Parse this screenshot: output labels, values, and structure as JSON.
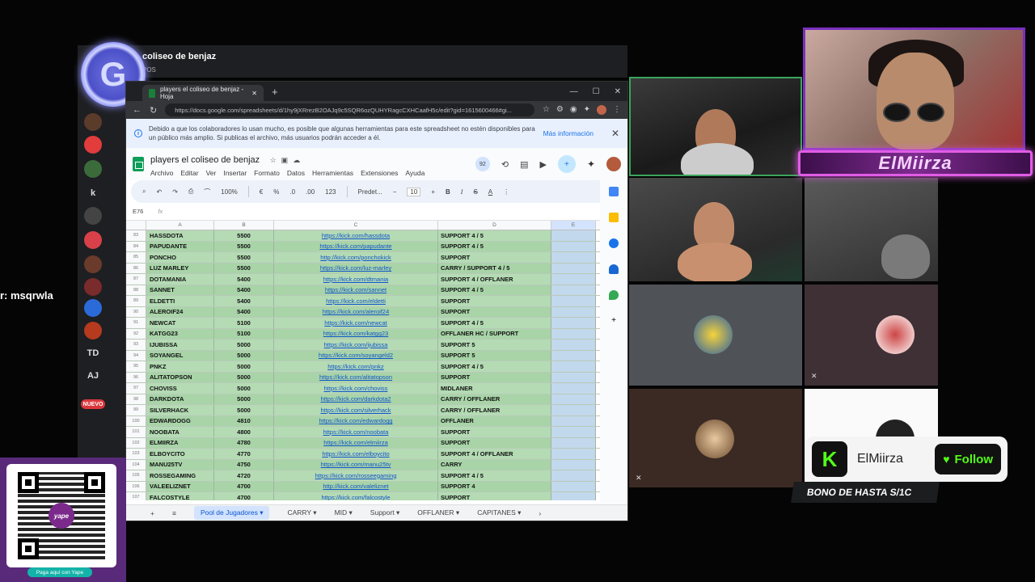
{
  "stream": {
    "side_text": "r: msqrwla",
    "streamer_name": "ElMiirza",
    "kick_follow_label": "Follow",
    "kick_logo": "K",
    "bono_text": "BONO DE HASTA S/1C",
    "yape_caption": "Paga aquí con Yape",
    "yape_logo": "yape"
  },
  "discord": {
    "logo_letter": "G",
    "server_name": "coliseo de benjaz",
    "server_sub": "POS",
    "badge_new": "NUEVO",
    "text_servers": [
      "k",
      "TD",
      "AJ"
    ]
  },
  "browser": {
    "tab_title": "players el coliseo de benjaz - Hoja",
    "url": "https://docs.google.com/spreadsheets/d/1hy9jXRrezB2OAJq9c5SQR6ozQUHYRagcCXHCaafH5c/edit?gid=1615600466#gi..."
  },
  "notice": {
    "message": "Debido a que los colaboradores lo usan mucho, es posible que algunas herramientas para este spreadsheet no estén disponibles para un público más amplio. Si publicas el archivo, más usuarios podrán acceder a él.",
    "more_link": "Más información"
  },
  "doc": {
    "title": "players el coliseo de benjaz",
    "menu": [
      "Archivo",
      "Editar",
      "Ver",
      "Insertar",
      "Formato",
      "Datos",
      "Herramientas",
      "Extensiones",
      "Ayuda"
    ],
    "badge": "92"
  },
  "toolbar": {
    "zoom": "100%",
    "currency": "€",
    "percent": "%",
    "dec_less": ".0",
    "dec_more": ".00",
    "num_format": "123",
    "font": "Predet...",
    "font_size": "10",
    "bold": "B",
    "italic": "I",
    "strike": "S",
    "color": "A"
  },
  "formula_bar": {
    "cell_ref": "E76",
    "fx": "fx"
  },
  "columns": [
    "A",
    "B",
    "C",
    "D",
    "E"
  ],
  "rows": [
    {
      "n": "83",
      "name": "HASSDOTA",
      "mmr": "5500",
      "link": "https://kick.com/hassdota",
      "role": "SUPPORT 4 / 5"
    },
    {
      "n": "84",
      "name": "PAPUDANTE",
      "mmr": "5500",
      "link": "https://kick.com/papudante",
      "role": "SUPPORT 4 / 5"
    },
    {
      "n": "85",
      "name": "PONCHO",
      "mmr": "5500",
      "link": "http://kick.com/ponchokick",
      "role": "SUPPORT"
    },
    {
      "n": "86",
      "name": "LUZ MARLEY",
      "mmr": "5500",
      "link": "https://kick.com/luz-marley",
      "role": "CARRY / SUPPORT 4 / 5"
    },
    {
      "n": "87",
      "name": "DOTAMANIA",
      "mmr": "5400",
      "link": "https://kick.com/dtmania",
      "role": "SUPPORT 4 / OFFLANER"
    },
    {
      "n": "88",
      "name": "SANNET",
      "mmr": "5400",
      "link": "https://kick.com/sannet",
      "role": "SUPPORT 4 / 5"
    },
    {
      "n": "89",
      "name": "ELDETTI",
      "mmr": "5400",
      "link": "https://kick.com/eldetti",
      "role": "SUPPORT"
    },
    {
      "n": "90",
      "name": "ALEROIF24",
      "mmr": "5400",
      "link": "https://kick.com/aleroif24",
      "role": "SUPPORT"
    },
    {
      "n": "91",
      "name": "NEWCAT",
      "mmr": "5100",
      "link": "https://kick.com/newcat",
      "role": "SUPPORT 4 / 5"
    },
    {
      "n": "92",
      "name": "KATGG23",
      "mmr": "5100",
      "link": "https://kick.com/katgg23",
      "role": "OFFLANER HC / SUPPORT"
    },
    {
      "n": "93",
      "name": "IJUBISSA",
      "mmr": "5000",
      "link": "https://kick.com/ijubissa",
      "role": "SUPPORT 5"
    },
    {
      "n": "94",
      "name": "SOYANGEL",
      "mmr": "5000",
      "link": "https://kick.com/soyangeld2",
      "role": "SUPPORT 5"
    },
    {
      "n": "95",
      "name": "PNKZ",
      "mmr": "5000",
      "link": "https://kick.com/pnkz",
      "role": "SUPPORT 4 / 5"
    },
    {
      "n": "96",
      "name": "ALITATOPSON",
      "mmr": "5000",
      "link": "https://kick.com/alitatopson",
      "role": "SUPPORT"
    },
    {
      "n": "97",
      "name": "CHOVISS",
      "mmr": "5000",
      "link": "https://kick.com/choviss",
      "role": "MIDLANER"
    },
    {
      "n": "98",
      "name": "DARKDOTA",
      "mmr": "5000",
      "link": "https://kick.com/darkdota2",
      "role": "CARRY / OFFLANER"
    },
    {
      "n": "99",
      "name": "SILVERHACK",
      "mmr": "5000",
      "link": "https://kick.com/silverhack",
      "role": "CARRY / OFFLANER"
    },
    {
      "n": "100",
      "name": "EDWARDOGG",
      "mmr": "4810",
      "link": "https://kick.com/edwardogg",
      "role": "OFFLANER"
    },
    {
      "n": "101",
      "name": "NOOBATA",
      "mmr": "4800",
      "link": "https://kick.com/noobata",
      "role": "SUPPORT"
    },
    {
      "n": "102",
      "name": "ELMIIRZA",
      "mmr": "4780",
      "link": "https://kick.com/elmiirza",
      "role": "SUPPORT"
    },
    {
      "n": "103",
      "name": "ELBOYCITO",
      "mmr": "4770",
      "link": "https://kick.com/elboycito",
      "role": "SUPPORT 4 / OFFLANER"
    },
    {
      "n": "104",
      "name": "MANU25TV",
      "mmr": "4750",
      "link": "https://kick.com/manu25tv",
      "role": "CARRY"
    },
    {
      "n": "105",
      "name": "ROSSEGAMING",
      "mmr": "4720",
      "link": "https://kick.com/rosseegaming",
      "role": "SUPPORT 4 / 5"
    },
    {
      "n": "106",
      "name": "VALEELIZNET",
      "mmr": "4700",
      "link": "http://kick.com/valeliznet",
      "role": "SUPPORT 4"
    },
    {
      "n": "107",
      "name": "FALCOSTYLE",
      "mmr": "4700",
      "link": "https://kick.com/falcostyle",
      "role": "SUPPORT"
    }
  ],
  "sheet_tabs": [
    "Pool de Jugadores",
    "CARRY",
    "MID",
    "Support",
    "OFFLANER",
    "CAPITANES"
  ]
}
